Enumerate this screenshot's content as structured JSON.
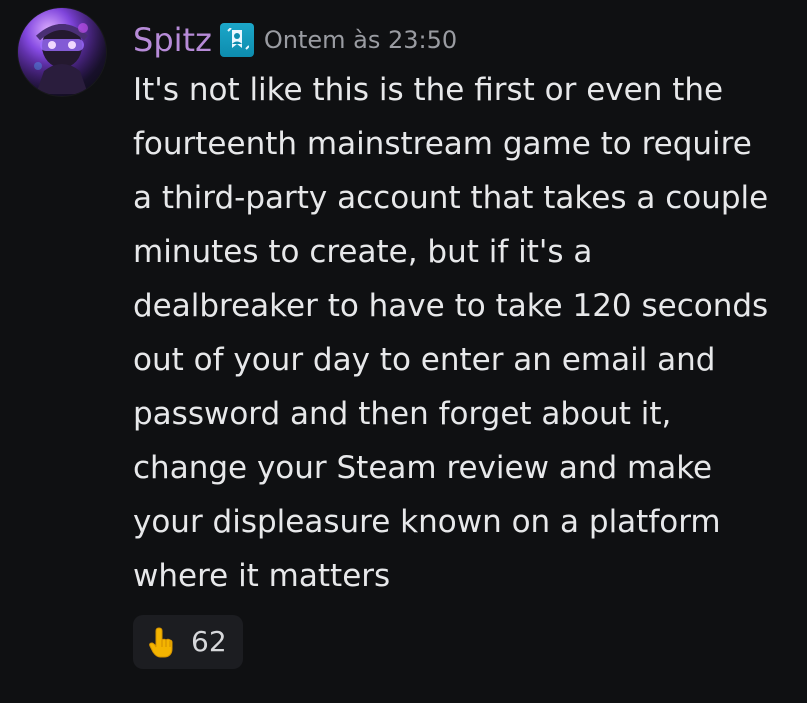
{
  "message": {
    "username": "Spitz",
    "timestamp": "Ontem às 23:50",
    "role_badge_icon": "bookmark-person-icon",
    "avatar_icon": "avatar-icon",
    "lines": [
      "It's not like this is the first or even the",
      "fourteenth mainstream game to require",
      "a third-party account that takes a couple",
      "minutes to create, but if it's a",
      "dealbreaker to have to take 120 seconds",
      "out of your day to enter an email and",
      "password and then forget about it,",
      "change your Steam review and make",
      "your displeasure known on a platform",
      "where it matters"
    ]
  },
  "reaction": {
    "emoji_name": "point-down-hand-icon",
    "count": "62"
  },
  "colors": {
    "background": "#0f1012",
    "username": "#b78bd8",
    "timestamp": "#9a9ca2",
    "message_text": "#e7e8ea",
    "reaction_bg": "#1c1d21",
    "role_badge": "#0d8cae"
  }
}
